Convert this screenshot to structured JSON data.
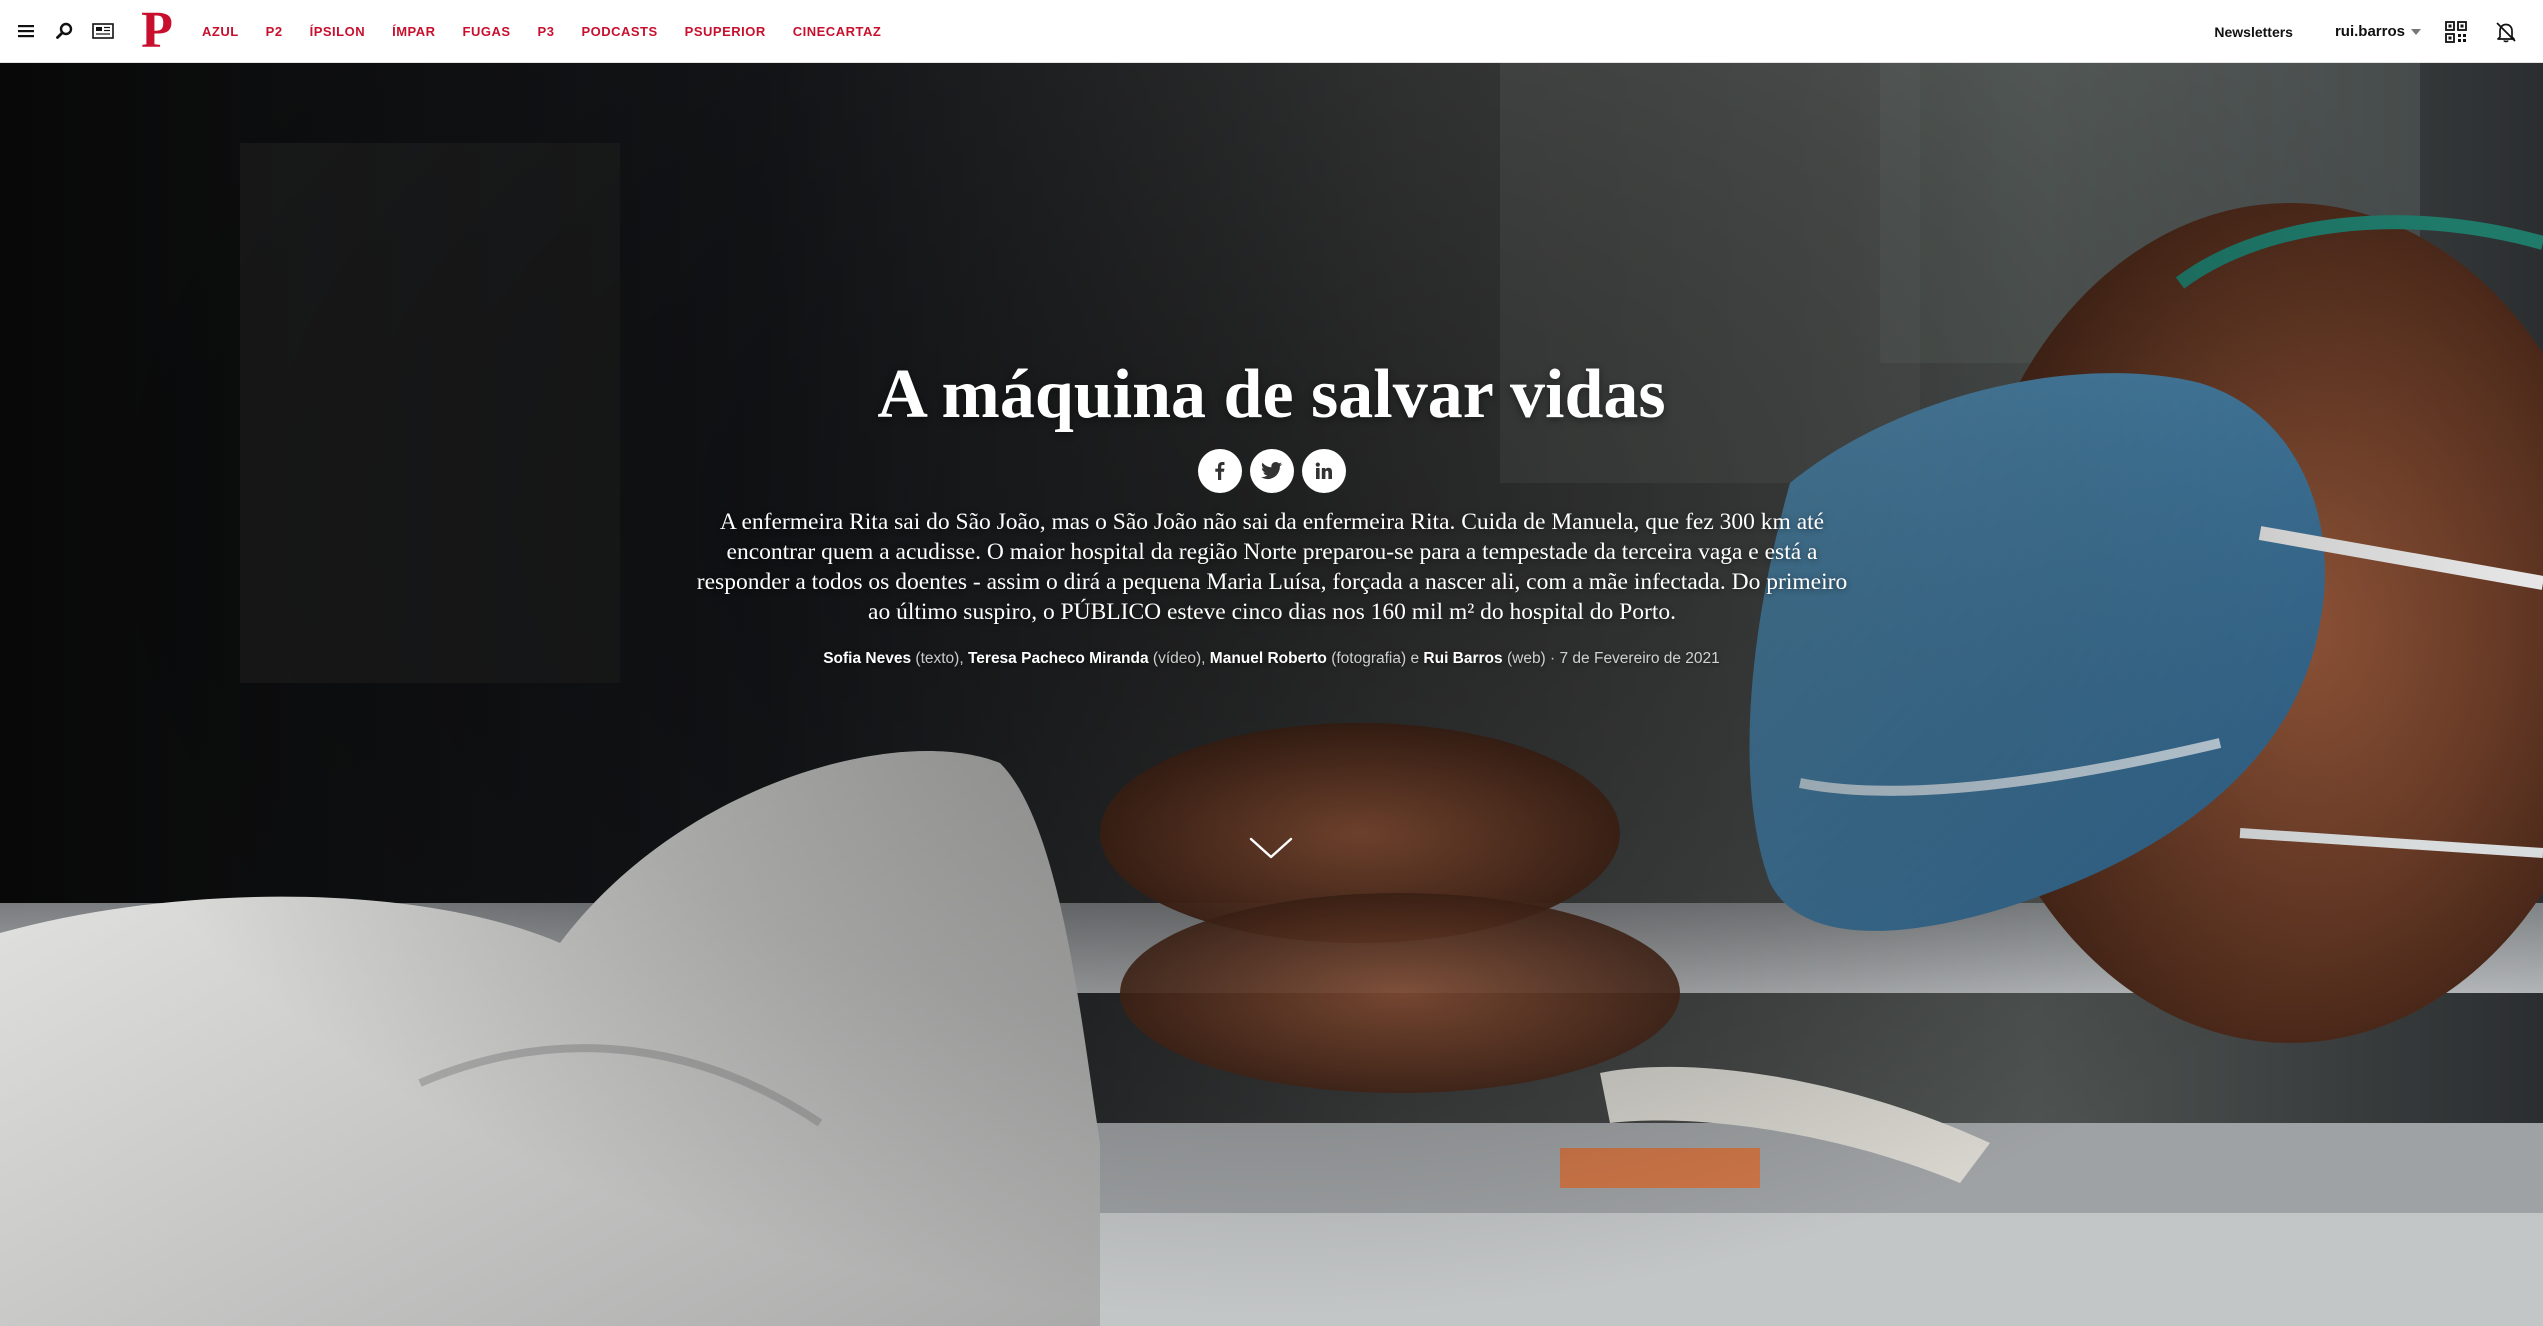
{
  "topbar": {
    "icons": [
      "menu-icon",
      "search-icon",
      "newspaper-edition-icon"
    ],
    "logo": "P",
    "sections": [
      "AZUL",
      "P2",
      "ÍPSILON",
      "ÍMPAR",
      "FUGAS",
      "P3",
      "PODCASTS",
      "PSUPERIOR",
      "CINECARTAZ"
    ],
    "newsletters_label": "Newsletters",
    "username": "rui.barros",
    "right_icons": [
      "qr-code-icon",
      "notifications-off-icon"
    ]
  },
  "article": {
    "headline": "A máquina de salvar vidas",
    "share": [
      "facebook-icon",
      "twitter-icon",
      "linkedin-icon"
    ],
    "lead": "A enfermeira Rita sai do São João, mas o São João não sai da enfermeira Rita. Cuida de Manuela, que fez 300 km até encontrar quem a acudisse. O maior hospital da região Norte preparou-se para a tempestade da terceira vaga e está a responder a todos os doentes - assim o dirá a pequena Maria Luísa, forçada a nascer ali, com a mãe infectada. Do primeiro ao último suspiro, o PÚBLICO esteve cinco dias nos 160 mil m² do hospital do Porto.",
    "byline": {
      "author1": "Sofia Neves",
      "role1": " (texto), ",
      "author2": "Teresa Pacheco Miranda",
      "role2": " (vídeo), ",
      "author3": "Manuel Roberto",
      "role3": " (fotografia) e ",
      "author4": "Rui Barros",
      "role4": " (web) · ",
      "date": "7 de Fevereiro de 2021"
    },
    "scroll_icon": "chevron-down-icon"
  },
  "colors": {
    "brand_red": "#c8102e",
    "topbar_bg": "#ffffff",
    "text_white": "#ffffff"
  }
}
